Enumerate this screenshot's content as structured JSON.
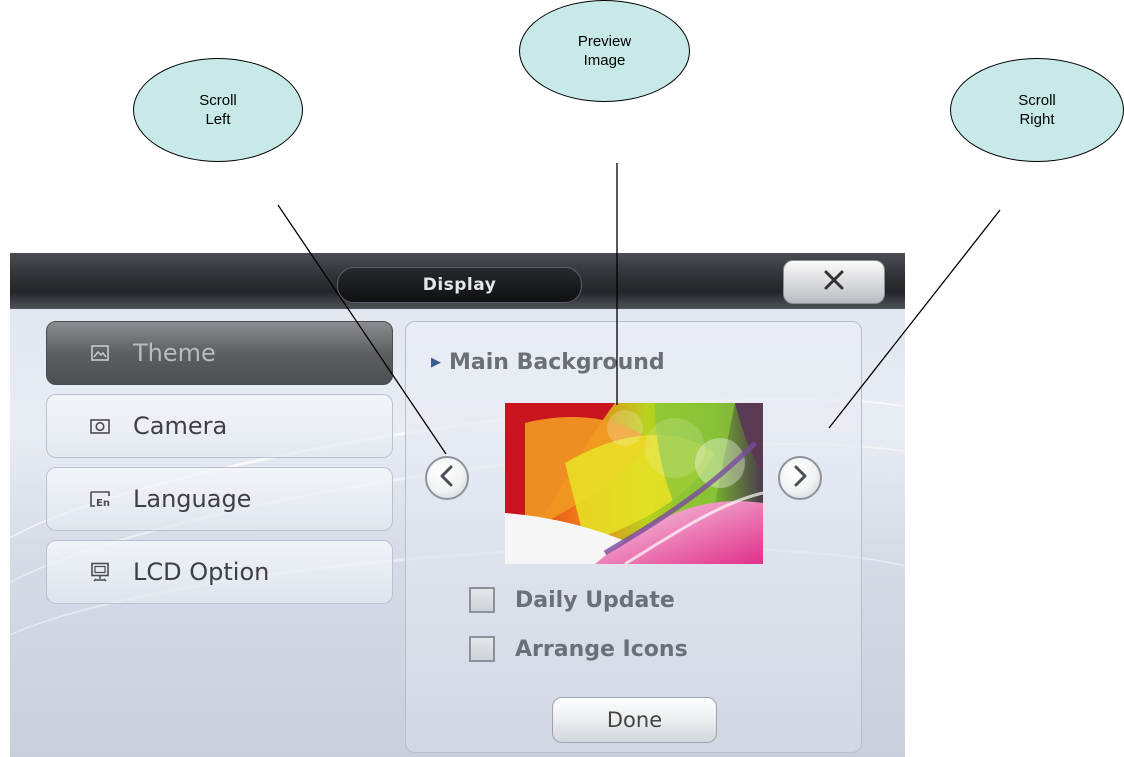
{
  "annotations": {
    "scroll_left": "Scroll\nLeft",
    "preview_image": "Preview\nImage",
    "scroll_right": "Scroll\nRight",
    "fill_color": "#c7e9e7"
  },
  "window": {
    "title": "Display",
    "close_icon": "close-icon"
  },
  "sidebar": {
    "items": [
      {
        "label": "Theme",
        "icon": "image-icon",
        "active": true
      },
      {
        "label": "Camera",
        "icon": "camera-icon",
        "active": false
      },
      {
        "label": "Language",
        "icon": "language-icon",
        "active": false
      },
      {
        "label": "LCD Option",
        "icon": "monitor-icon",
        "active": false
      }
    ]
  },
  "panel": {
    "heading": "Main Background",
    "heading_marker_color": "#3e5a95",
    "scroll_left_icon": "chevron-left-icon",
    "scroll_right_icon": "chevron-right-icon",
    "options": [
      {
        "label": "Daily Update",
        "checked": false
      },
      {
        "label": "Arrange Icons",
        "checked": false
      }
    ],
    "done_label": "Done"
  }
}
